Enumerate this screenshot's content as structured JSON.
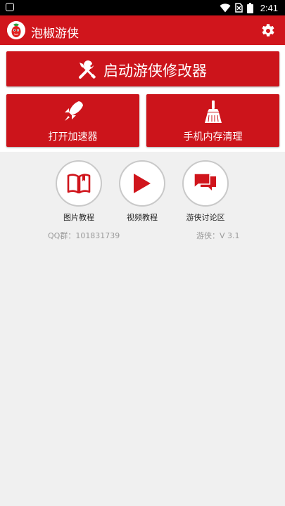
{
  "status_bar": {
    "time": "2:41"
  },
  "app_bar": {
    "title": "泡椒游侠"
  },
  "actions": {
    "launch_label": "启动游侠修改器",
    "accelerator_label": "打开加速器",
    "cleaner_label": "手机内存清理"
  },
  "tutorials": [
    {
      "label": "图片教程",
      "icon": "book-icon"
    },
    {
      "label": "视频教程",
      "icon": "play-icon"
    },
    {
      "label": "游侠讨论区",
      "icon": "chat-icon"
    }
  ],
  "footer": {
    "qq_group": "QQ群：101831739",
    "version": "游侠：V 3.1"
  },
  "colors": {
    "brand_red": "#d0151c",
    "button_red": "#cc141b",
    "background": "#f0f0f0"
  }
}
